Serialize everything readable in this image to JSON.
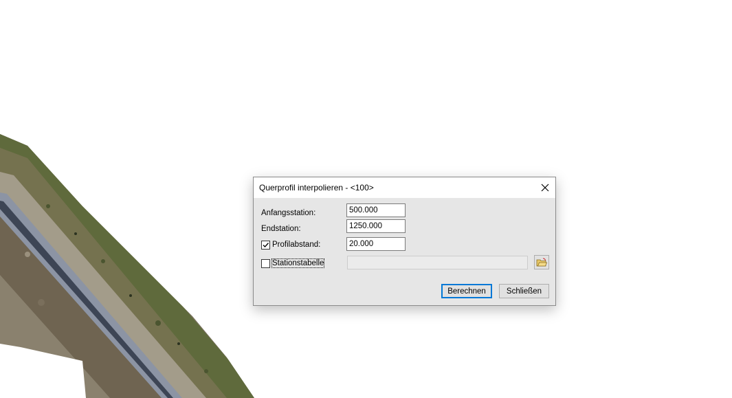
{
  "dialog": {
    "title": "Querprofil interpolieren - <100>",
    "close_icon": "close-icon",
    "fields": {
      "anfangsstation": {
        "label": "Anfangsstation:",
        "value": "500.000"
      },
      "endstation": {
        "label": "Endstation:",
        "value": "1250.000"
      },
      "profilabstand": {
        "label": "Profilabstand:",
        "value": "20.000",
        "checked": true
      },
      "stationstabelle": {
        "label": "Stationstabelle",
        "value": "",
        "checked": false
      }
    },
    "buttons": {
      "browse_icon": "open-folder-icon",
      "compute": "Berechnen",
      "close": "Schließen"
    }
  },
  "background": {
    "description_icon": "aerial-map",
    "colors": {
      "vegetation": "#5c6b3a",
      "soil": "#8d8270",
      "track": "#6e7f95"
    }
  }
}
